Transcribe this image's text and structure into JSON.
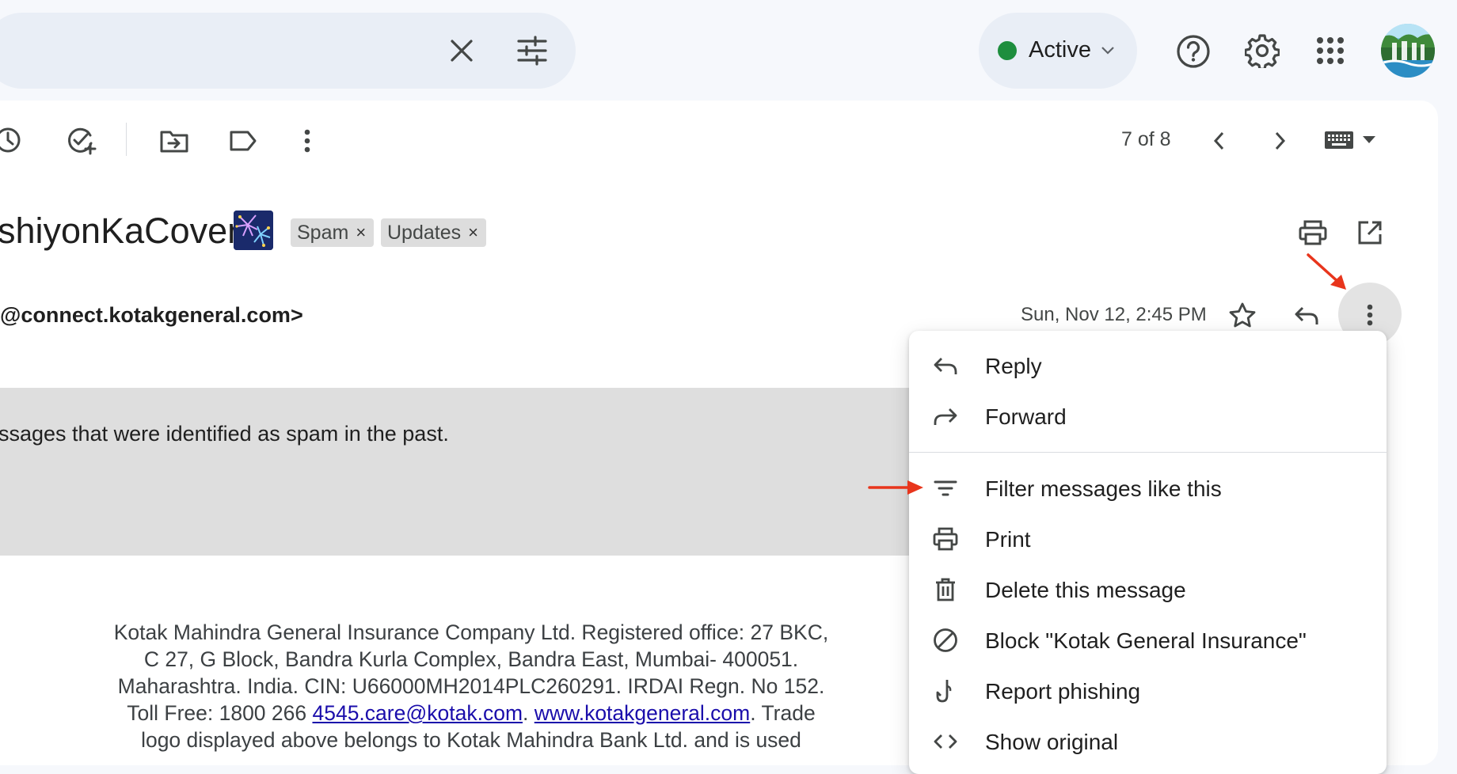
{
  "header": {
    "status": {
      "label": "Active"
    },
    "icons": [
      "close-icon",
      "tune-icon",
      "chevron-down-icon",
      "help-icon",
      "settings-gear-icon",
      "apps-grid-icon",
      "avatar"
    ]
  },
  "toolbar": {
    "page_count": "7 of 8",
    "icons": [
      "snooze-clock-icon",
      "add-to-tasks-icon",
      "move-to-folder-icon",
      "label-icon",
      "more-vert-icon",
      "prev-chevron-icon",
      "next-chevron-icon",
      "keyboard-icon",
      "dropdown-triangle-icon"
    ]
  },
  "email": {
    "subject": "shiyonKaCover",
    "labels": [
      {
        "text": "Spam",
        "remove": "×"
      },
      {
        "text": "Updates",
        "remove": "×"
      }
    ],
    "sender": "@connect.kotakgeneral.com>",
    "date": "Sun, Nov 12, 2:45 PM",
    "spam_notice": "ssages that were identified as spam in the past.",
    "footer": {
      "line1": "Kotak Mahindra General Insurance Company Ltd. Registered office: 27 BKC,",
      "line2": "C 27, G Block, Bandra Kurla Complex, Bandra East, Mumbai- 400051.",
      "line3": "Maharashtra. India. CIN: U66000MH2014PLC260291. IRDAI Regn. No 152.",
      "line4_pre": "Toll Free: 1800 266 ",
      "email_link": "4545.care@kotak.com",
      "sep": ". ",
      "web_link": "www.kotakgeneral.com",
      "line4_post": ". Trade",
      "line5": "logo displayed above belongs to Kotak Mahindra Bank Ltd. and is used"
    }
  },
  "menu": {
    "items": [
      {
        "label": "Reply",
        "icon": "reply-icon"
      },
      {
        "label": "Forward",
        "icon": "forward-icon"
      },
      {
        "label": "Filter messages like this",
        "icon": "filter-icon"
      },
      {
        "label": "Print",
        "icon": "print-icon"
      },
      {
        "label": "Delete this message",
        "icon": "trash-icon"
      },
      {
        "label": "Block \"Kotak General Insurance\"",
        "icon": "block-icon"
      },
      {
        "label": "Report phishing",
        "icon": "phishing-hook-icon"
      },
      {
        "label": "Show original",
        "icon": "code-icon"
      }
    ]
  },
  "colors": {
    "background": "#f6f8fc",
    "chip_bg": "#e9eef6",
    "active_dot": "#1e8e3e",
    "annotation_arrow": "#e8351c",
    "link": "#1a0dab",
    "spam_banner": "#dedede"
  }
}
